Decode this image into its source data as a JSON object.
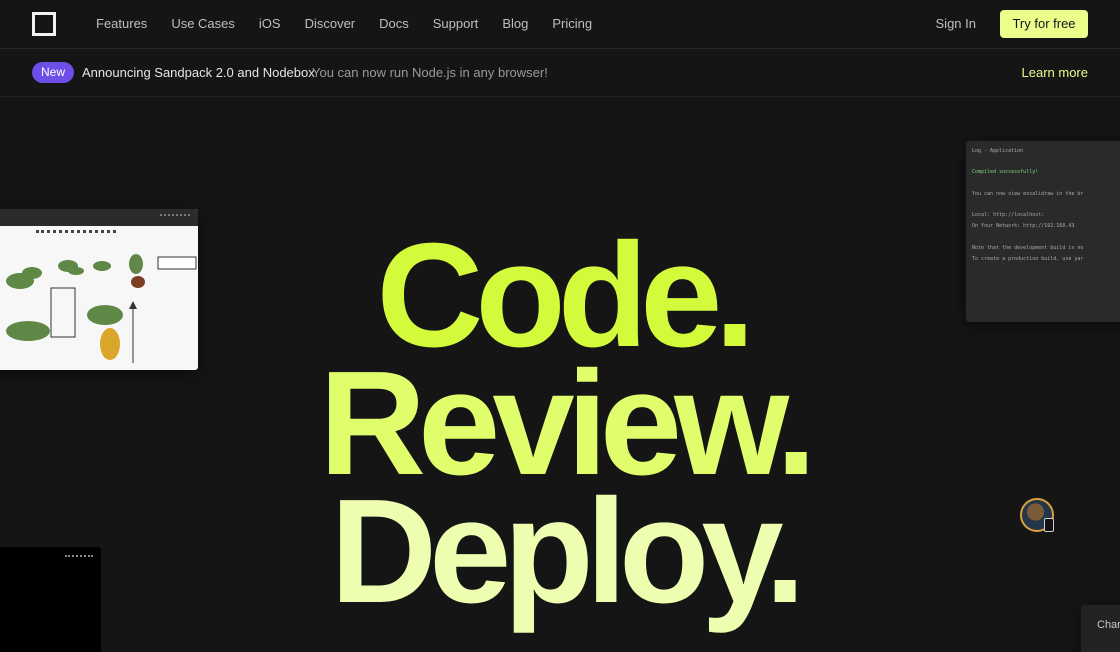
{
  "nav": {
    "logo_icon": "square-logo-icon",
    "links": [
      "Features",
      "Use Cases",
      "iOS",
      "Discover",
      "Docs",
      "Support",
      "Blog",
      "Pricing"
    ],
    "sign_in": "Sign In",
    "cta": "Try for free"
  },
  "announcement": {
    "badge": "New",
    "title": "Announcing Sandpack 2.0 and Nodebox",
    "subtitle": "You can now run Node.js in any browser!",
    "link": "Learn more"
  },
  "hero": {
    "lines": [
      "Code.",
      "Review.",
      "Deploy."
    ]
  },
  "terminal_preview": {
    "title": "Log - Application",
    "lines": [
      "Compiled successfully!",
      "You can now view excalidraw in the br",
      "  Local:           http://localhost:",
      "  On Your Network:  http://192.168.43",
      "Note that the development build is no",
      "To create a production build, use yar"
    ]
  },
  "corner_card": {
    "label": "Char"
  },
  "colors": {
    "background": "#151515",
    "accent": "#ecfd8c",
    "badge": "#6d4ee6",
    "hero_code": "#d4fb3b",
    "hero_review": "#e0fd6c",
    "hero_deploy": "#edfeb0"
  }
}
